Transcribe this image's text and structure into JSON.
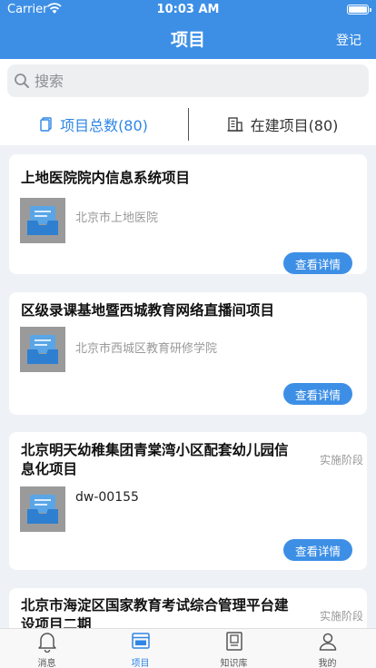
{
  "status_bar": {
    "carrier": "Carrier",
    "time": "10:03 AM"
  },
  "nav": {
    "title": "项目",
    "right_action": "登记"
  },
  "search": {
    "placeholder": "搜索"
  },
  "tabs": [
    {
      "label": "项目总数(80)"
    },
    {
      "label": "在建项目(80)"
    }
  ],
  "projects": [
    {
      "title": "上地医院院内信息系统项目",
      "subtitle": "北京市上地医院",
      "stage": "",
      "button": "查看详情"
    },
    {
      "title": "区级录课基地暨西城教育网络直播间项目",
      "subtitle": "北京市西城区教育研修学院",
      "stage": "",
      "button": "查看详情"
    },
    {
      "title": "北京明天幼稚集团青棠湾小区配套幼儿园信息化项目",
      "subtitle": "dw-00155",
      "stage": "实施阶段",
      "button": "查看详情"
    },
    {
      "title": "北京市海淀区国家教育考试综合管理平台建设项目二期",
      "subtitle": "",
      "stage": "实施阶段",
      "button": ""
    }
  ],
  "tab_bar": [
    {
      "label": "消息",
      "icon": "bell-icon"
    },
    {
      "label": "项目",
      "icon": "project-icon"
    },
    {
      "label": "知识库",
      "icon": "book-icon"
    },
    {
      "label": "我的",
      "icon": "person-icon"
    }
  ],
  "colors": {
    "primary": "#3d8fe6",
    "background": "#eef1f6"
  }
}
